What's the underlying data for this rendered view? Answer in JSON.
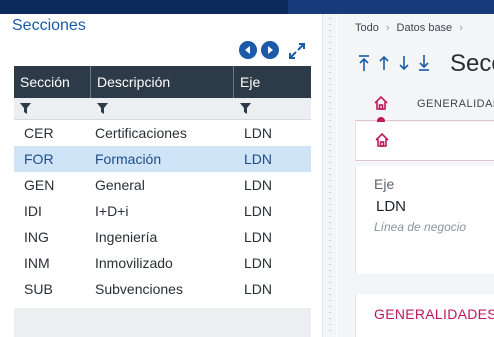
{
  "left": {
    "title": "Secciones",
    "columns": [
      "Sección",
      "Descripción",
      "Eje"
    ],
    "rows": [
      {
        "seccion": "CER",
        "descripcion": "Certificaciones",
        "eje": "LDN"
      },
      {
        "seccion": "FOR",
        "descripcion": "Formación",
        "eje": "LDN",
        "selected": true
      },
      {
        "seccion": "GEN",
        "descripcion": "General",
        "eje": "LDN"
      },
      {
        "seccion": "IDI",
        "descripcion": "I+D+i",
        "eje": "LDN"
      },
      {
        "seccion": "ING",
        "descripcion": "Ingeniería",
        "eje": "LDN"
      },
      {
        "seccion": "INM",
        "descripcion": "Inmovilizado",
        "eje": "LDN"
      },
      {
        "seccion": "SUB",
        "descripcion": "Subvenciones",
        "eje": "LDN"
      }
    ],
    "icons": [
      "prev-icon",
      "next-icon",
      "expand-icon",
      "filter-icon"
    ]
  },
  "right": {
    "breadcrumb": [
      "Todo",
      "Datos base"
    ],
    "title": "Secc",
    "tab_label": "GENERALIDAD",
    "field_label": "Eje",
    "field_value": "LDN",
    "field_hint": "Línea de negocio",
    "section_title": "GENERALIDADES"
  },
  "colors": {
    "accent_blue": "#1a5aa8",
    "header_dark": "#2d3a47",
    "selected_row": "#cfe4f7",
    "accent_pink": "#c2185b"
  }
}
